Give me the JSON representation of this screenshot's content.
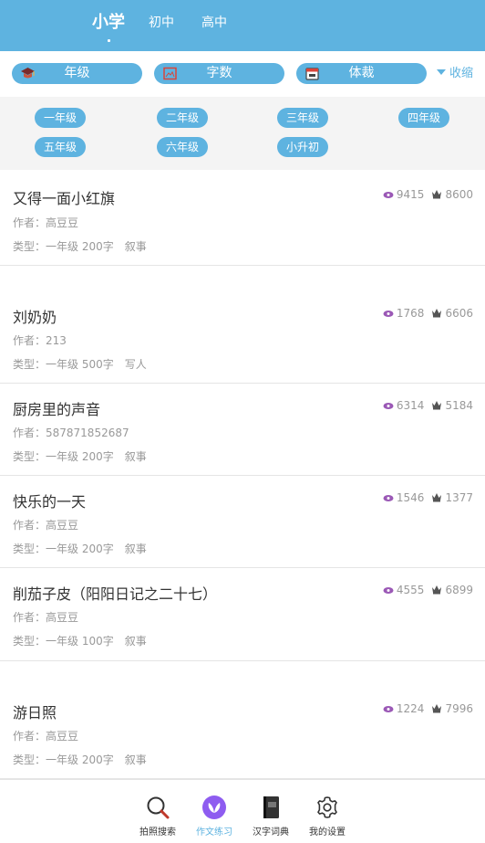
{
  "colors": {
    "accent": "#5eb3e0",
    "eye": "#9b59b6",
    "active_nav": "#8e5cf0"
  },
  "header": {
    "tabs": [
      {
        "label": "小学",
        "active": true
      },
      {
        "label": "初中",
        "active": false
      },
      {
        "label": "高中",
        "active": false
      }
    ]
  },
  "filters": {
    "items": [
      {
        "label": "年级",
        "icon": "graduation-cap-icon"
      },
      {
        "label": "字数",
        "icon": "picture-frame-icon"
      },
      {
        "label": "体裁",
        "icon": "calendar-icon"
      }
    ],
    "collapse_label": "收缩"
  },
  "grades": [
    "一年级",
    "二年级",
    "三年级",
    "四年级",
    "五年级",
    "六年级",
    "小升初"
  ],
  "articles": [
    {
      "title": "又得一面小红旗",
      "author": "作者：高豆豆",
      "type": "类型：一年级 200字　叙事",
      "views": "9415",
      "likes": "8600"
    },
    {
      "title": "刘奶奶",
      "author": "作者：213",
      "type": "类型：一年级 500字　写人",
      "views": "1768",
      "likes": "6606"
    },
    {
      "title": "厨房里的声音",
      "author": "作者：587871852687",
      "type": "类型：一年级 200字　叙事",
      "views": "6314",
      "likes": "5184"
    },
    {
      "title": "快乐的一天",
      "author": "作者：高豆豆",
      "type": "类型：一年级 200字　叙事",
      "views": "1546",
      "likes": "1377"
    },
    {
      "title": "削茄子皮（阳阳日记之二十七）",
      "author": "作者：高豆豆",
      "type": "类型：一年级 100字　叙事",
      "views": "4555",
      "likes": "6899"
    },
    {
      "title": "游日照",
      "author": "作者：高豆豆",
      "type": "类型：一年级 200字　叙事",
      "views": "1224",
      "likes": "7996"
    }
  ],
  "bottom_nav": [
    {
      "label": "拍照搜索",
      "icon": "magnifier-icon",
      "active": false
    },
    {
      "label": "作文练习",
      "icon": "leaf-icon",
      "active": true
    },
    {
      "label": "汉字词典",
      "icon": "dictionary-book-icon",
      "active": false
    },
    {
      "label": "我的设置",
      "icon": "gear-icon",
      "active": false
    }
  ]
}
